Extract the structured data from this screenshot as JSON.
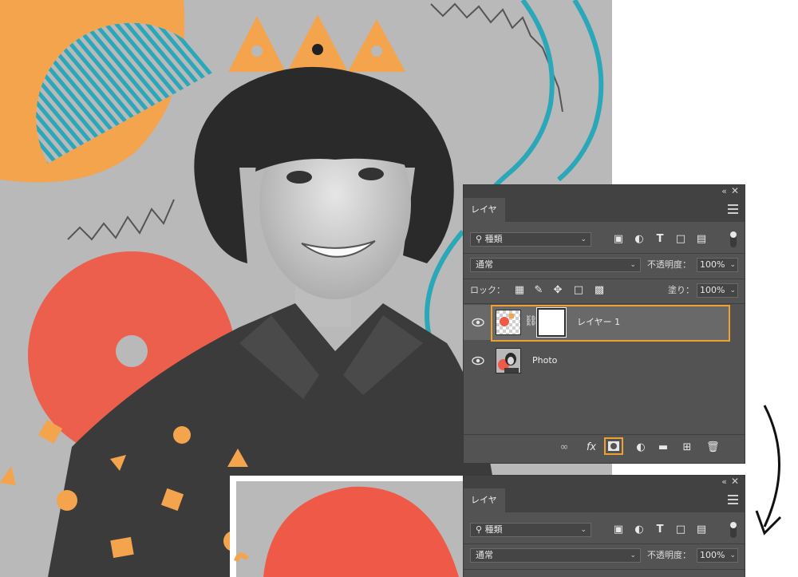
{
  "panel_top": {
    "tab_label": "レイヤー",
    "filter_kind": "種類",
    "blend_mode": "通常",
    "opacity_label": "不透明度：",
    "opacity_value": "100%",
    "lock_label": "ロック：",
    "fill_label": "塗り：",
    "fill_value": "100%",
    "layers": [
      {
        "name": "レイヤー 1",
        "selected": true,
        "has_mask": true
      },
      {
        "name": "Photo",
        "selected": false,
        "has_mask": false
      }
    ],
    "footer_icons": [
      "link-icon",
      "fx-icon",
      "add-mask-icon",
      "adjustment-icon",
      "folder-icon",
      "new-layer-icon",
      "trash-icon"
    ],
    "fx_label": "fx"
  },
  "panel_bottom": {
    "tab_label": "レイヤー",
    "filter_kind": "種類",
    "blend_mode": "通常",
    "opacity_label": "不透明度：",
    "opacity_value": "100%"
  },
  "colors": {
    "accent_orange": "#f0a030",
    "panel_bg": "#535353",
    "panel_dark": "#424242",
    "selected_row": "#696969",
    "canvas_bg": "#b9b9b9",
    "coral": "#ee5a47",
    "teal": "#2aa7b8",
    "orange_shape": "#f3a44c"
  }
}
